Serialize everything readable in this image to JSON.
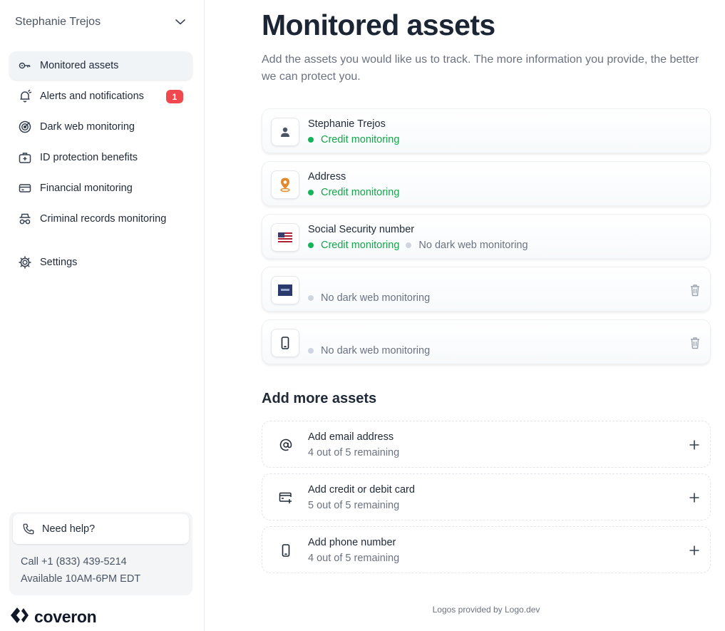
{
  "sidebar": {
    "user_name": "Stephanie Trejos",
    "items": [
      {
        "label": "Monitored assets",
        "icon": "key-icon"
      },
      {
        "label": "Alerts and notifications",
        "icon": "bell-icon",
        "badge": "1"
      },
      {
        "label": "Dark web monitoring",
        "icon": "radar-icon"
      },
      {
        "label": "ID protection benefits",
        "icon": "briefcase-icon"
      },
      {
        "label": "Financial monitoring",
        "icon": "credit-card-icon"
      },
      {
        "label": "Criminal records monitoring",
        "icon": "spy-icon"
      }
    ],
    "settings_label": "Settings",
    "help": {
      "button_label": "Need help?",
      "phone": "Call +1 (833) 439-5214",
      "hours": "Available 10AM-6PM EDT"
    },
    "brand": "coveron"
  },
  "main": {
    "title": "Monitored assets",
    "subtitle": "Add the assets you would like us to track. The more information you provide, the better we can protect you.",
    "assets": [
      {
        "title": "Stephanie Trejos",
        "icon": "person-icon",
        "statuses": [
          {
            "text": "Credit monitoring",
            "state": "active"
          }
        ]
      },
      {
        "title": "Address",
        "icon": "location-pin-icon",
        "statuses": [
          {
            "text": "Credit monitoring",
            "state": "active"
          }
        ]
      },
      {
        "title": "Social Security number",
        "icon": "us-flag-icon",
        "statuses": [
          {
            "text": "Credit monitoring",
            "state": "active"
          },
          {
            "text": "No dark web monitoring",
            "state": "inactive"
          }
        ]
      },
      {
        "title": "",
        "icon": "bank-logo-icon",
        "statuses": [
          {
            "text": "No dark web monitoring",
            "state": "inactive"
          }
        ]
      },
      {
        "title": "",
        "icon": "phone-icon",
        "statuses": [
          {
            "text": "No dark web monitoring",
            "state": "inactive"
          }
        ]
      }
    ],
    "add_section_title": "Add more assets",
    "add_items": [
      {
        "title": "Add email address",
        "subtitle": "4 out of 5 remaining",
        "icon": "at-sign-icon"
      },
      {
        "title": "Add credit or debit card",
        "subtitle": "5 out of 5 remaining",
        "icon": "add-card-icon"
      },
      {
        "title": "Add phone number",
        "subtitle": "4 out of 5 remaining",
        "icon": "phone-icon"
      }
    ],
    "footer_note": "Logos provided by Logo.dev"
  },
  "colors": {
    "active_status": "#16a34a",
    "inactive_dot": "#cfd6df",
    "badge": "#f0484f",
    "nav_active_bg": "#f1f4f7"
  }
}
